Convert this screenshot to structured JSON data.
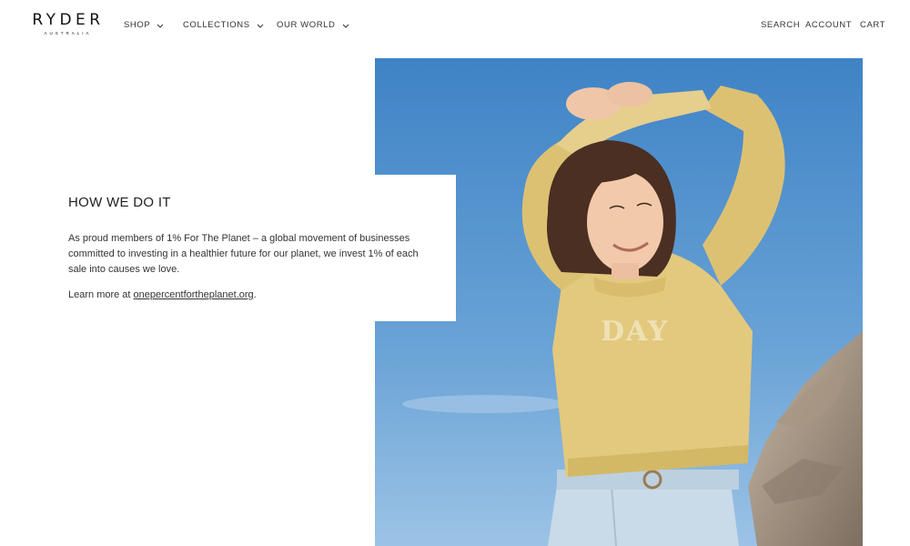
{
  "brand": {
    "name": "RYDER",
    "tagline": "AUSTRALIA"
  },
  "nav": {
    "items": [
      {
        "label": "SHOP"
      },
      {
        "label": "COLLECTIONS"
      },
      {
        "label": "OUR WORLD"
      }
    ]
  },
  "utility": {
    "search": "SEARCH",
    "account": "ACCOUNT",
    "cart": "CART"
  },
  "section": {
    "title": "HOW WE DO IT",
    "body": "As proud members of 1% For The Planet – a global movement of businesses committed to investing in a healthier future for our planet, we invest 1% of each sale into causes we love.",
    "learn_prefix": "Learn more at ",
    "link_text": "onepercentfortheplanet.org",
    "learn_suffix": "."
  },
  "photo": {
    "sweater_text": "DAY",
    "colors": {
      "sky": "#4f8fcc",
      "sweater": "#e2c97e",
      "hair": "#4a2f22",
      "jeans": "#c9dbe8"
    }
  }
}
